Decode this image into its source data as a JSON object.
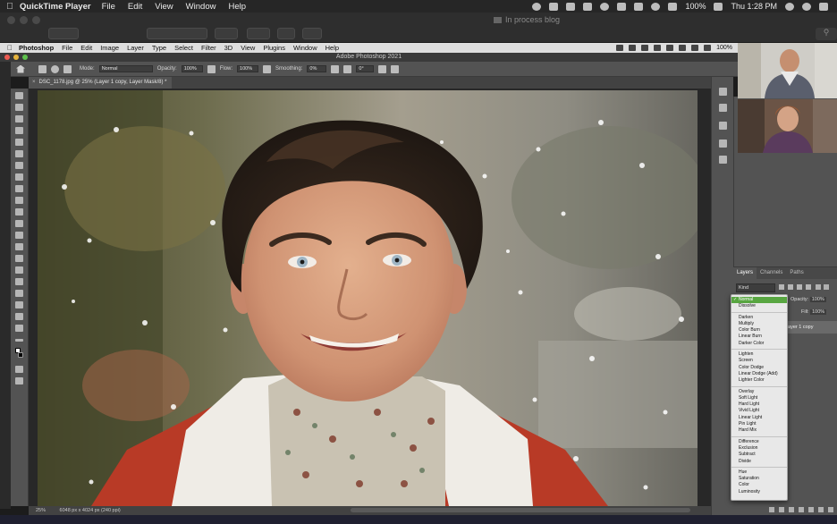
{
  "mac_menubar": {
    "app": "QuickTime Player",
    "menus": [
      "File",
      "Edit",
      "View",
      "Window",
      "Help"
    ],
    "battery": "100%",
    "clock": "Thu 1:28 PM"
  },
  "finder_window": {
    "title": "In process blog"
  },
  "ps_menubar": {
    "app": "Photoshop",
    "menus": [
      "File",
      "Edit",
      "Image",
      "Layer",
      "Type",
      "Select",
      "Filter",
      "3D",
      "View",
      "Plugins",
      "Window",
      "Help"
    ],
    "battery": "100%"
  },
  "ps_window": {
    "title": "Adobe Photoshop 2021"
  },
  "options": {
    "mode_label": "Mode:",
    "mode_value": "Normal",
    "opacity_label": "Opacity:",
    "opacity_value": "100%",
    "flow_label": "Flow:",
    "flow_value": "100%",
    "smoothing_label": "Smoothing:",
    "smoothing_value": "0%",
    "angle_value": "0°"
  },
  "document": {
    "tab": "DSC_1178.jpg @ 25% (Layer 1 copy, Layer Mask/8) *",
    "zoom": "25%",
    "dims": "6048 px x 4024 px (240 ppi)"
  },
  "layers_panel": {
    "tabs": [
      "Layers",
      "Channels",
      "Paths"
    ],
    "kind": "Kind",
    "opacity_label": "Opacity:",
    "opacity_value": "100%",
    "fill_label": "Fill:",
    "fill_value": "100%",
    "layer_name": "Layer 1 copy"
  },
  "blend_menu": {
    "selected": "Normal",
    "groups": [
      [
        "Normal",
        "Dissolve"
      ],
      [
        "Darken",
        "Multiply",
        "Color Burn",
        "Linear Burn",
        "Darker Color"
      ],
      [
        "Lighten",
        "Screen",
        "Color Dodge",
        "Linear Dodge (Add)",
        "Lighter Color"
      ],
      [
        "Overlay",
        "Soft Light",
        "Hard Light",
        "Vivid Light",
        "Linear Light",
        "Pin Light",
        "Hard Mix"
      ],
      [
        "Difference",
        "Exclusion",
        "Subtract",
        "Divide"
      ],
      [
        "Hue",
        "Saturation",
        "Color",
        "Luminosity"
      ]
    ]
  },
  "colors": {
    "ps_panel": "#535353",
    "selected_item": "#58a641",
    "jacket": "#b83a26"
  }
}
